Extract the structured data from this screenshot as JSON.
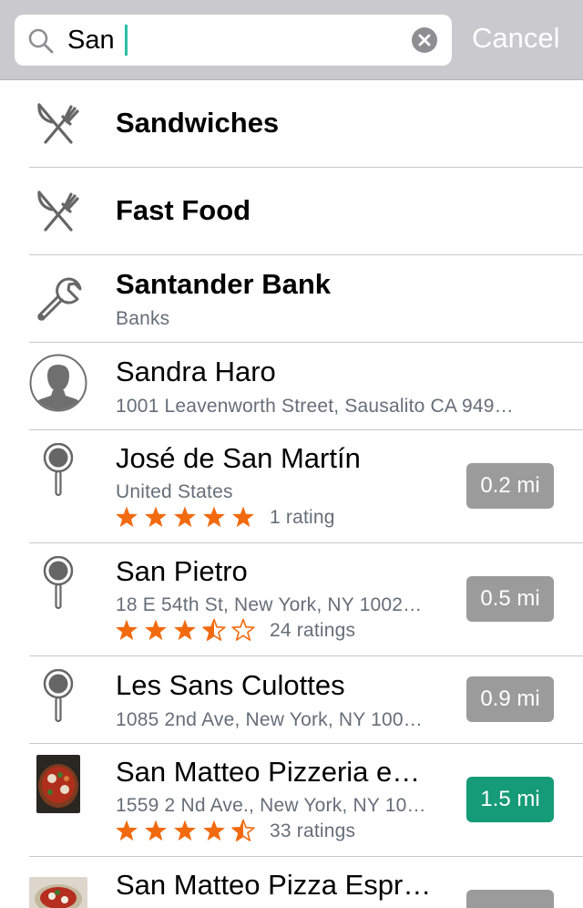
{
  "search": {
    "query": "San",
    "cancel_label": "Cancel"
  },
  "colors": {
    "star": "#f26a0f",
    "distance_gray": "#9b9b9b",
    "distance_green": "#159b78",
    "caret": "#2bbfa5"
  },
  "results": [
    {
      "title": "Sandwiches",
      "icon": "fork-knife-icon"
    },
    {
      "title": "Fast Food",
      "icon": "fork-knife-icon"
    },
    {
      "title": "Santander Bank",
      "subtitle": "Banks",
      "icon": "wrench-icon"
    },
    {
      "title": "Sandra Haro",
      "subtitle": "1001  Leavenworth Street, Sausalito CA 949…",
      "icon": "contact-avatar-icon"
    },
    {
      "title": "José de San Martín",
      "subtitle": "United States",
      "rating": 5,
      "ratings_text": "1 rating",
      "distance": "0.2 mi",
      "icon": "map-pin-icon"
    },
    {
      "title": "San Pietro",
      "subtitle": "18 E 54th St, New York, NY 1002…",
      "rating": 3.5,
      "ratings_text": "24 ratings",
      "distance": "0.5 mi",
      "icon": "map-pin-icon"
    },
    {
      "title": "Les Sans Culottes",
      "subtitle": "1085 2nd Ave, New York, NY 100…",
      "distance": "0.9 mi",
      "icon": "map-pin-icon"
    },
    {
      "title": "San Matteo Pizzeria e…",
      "subtitle": "1559 2 Nd Ave., New York, NY 10…",
      "rating": 4.5,
      "ratings_text": "33 ratings",
      "distance": "1.5 mi",
      "icon": "pizza-photo"
    },
    {
      "title": "San Matteo Pizza Espr…",
      "icon": "pizza-photo"
    }
  ]
}
